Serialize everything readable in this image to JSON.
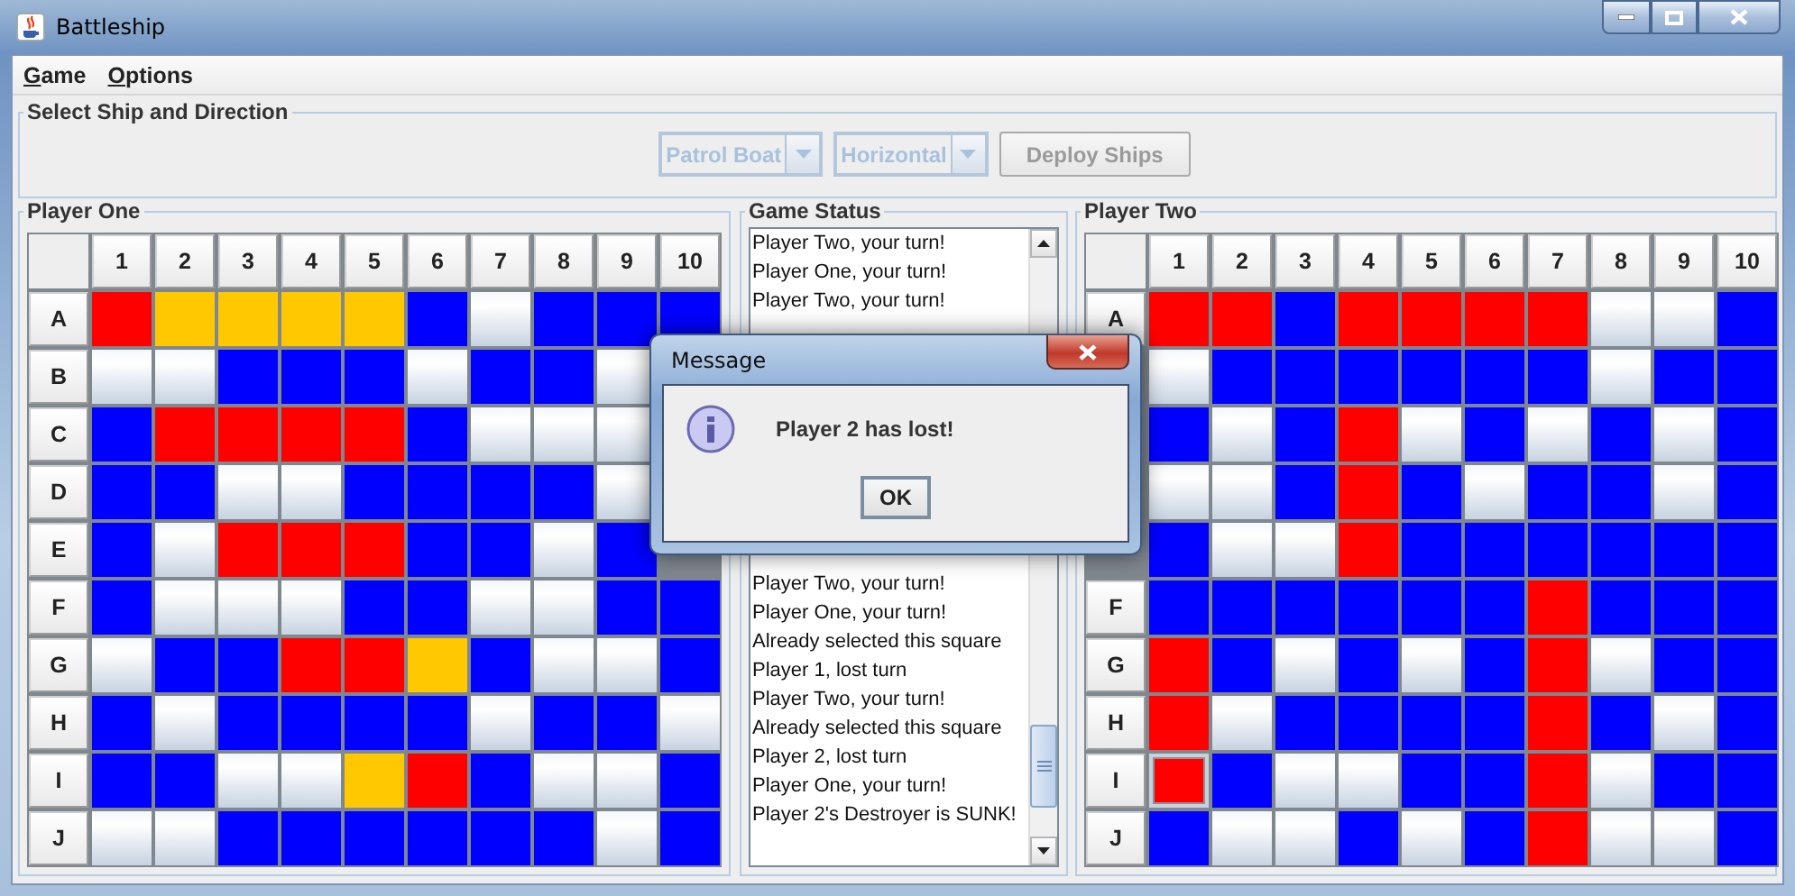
{
  "window": {
    "title": "Battleship"
  },
  "menu": [
    "Game",
    "Options"
  ],
  "setup": {
    "title": "Select Ship and Direction",
    "ship": {
      "value": "Patrol Boat",
      "disabled": true
    },
    "direction": {
      "value": "Horizontal",
      "disabled": true
    },
    "deploy": {
      "label": "Deploy Ships",
      "disabled": true
    }
  },
  "boards": [
    {
      "title": "Player One",
      "columns": [
        "1",
        "2",
        "3",
        "4",
        "5",
        "6",
        "7",
        "8",
        "9",
        "10"
      ],
      "rows": [
        {
          "label": "A",
          "cells": [
            {
              "kind": "hit"
            },
            {
              "kind": "ship"
            },
            {
              "kind": "ship"
            },
            {
              "kind": "ship"
            },
            {
              "kind": "ship"
            },
            {
              "kind": "water"
            },
            {
              "kind": "miss"
            },
            {
              "kind": "water"
            },
            {
              "kind": "water"
            },
            {
              "kind": "water"
            }
          ]
        },
        {
          "label": "B",
          "cells": [
            {
              "kind": "miss"
            },
            {
              "kind": "miss"
            },
            {
              "kind": "water"
            },
            {
              "kind": "water"
            },
            {
              "kind": "water"
            },
            {
              "kind": "miss"
            },
            {
              "kind": "water"
            },
            {
              "kind": "water"
            },
            {
              "kind": "miss"
            }
          ]
        },
        {
          "label": "C",
          "cells": [
            {
              "kind": "water"
            },
            {
              "kind": "hit"
            },
            {
              "kind": "hit"
            },
            {
              "kind": "hit"
            },
            {
              "kind": "hit"
            },
            {
              "kind": "water"
            },
            {
              "kind": "miss"
            },
            {
              "kind": "miss"
            },
            {
              "kind": "miss"
            }
          ]
        },
        {
          "label": "D",
          "cells": [
            {
              "kind": "water"
            },
            {
              "kind": "water"
            },
            {
              "kind": "miss"
            },
            {
              "kind": "miss"
            },
            {
              "kind": "water"
            },
            {
              "kind": "water"
            },
            {
              "kind": "water"
            },
            {
              "kind": "water"
            },
            {
              "kind": "miss"
            }
          ]
        },
        {
          "label": "E",
          "cells": [
            {
              "kind": "water"
            },
            {
              "kind": "miss"
            },
            {
              "kind": "hit"
            },
            {
              "kind": "hit"
            },
            {
              "kind": "hit"
            },
            {
              "kind": "water"
            },
            {
              "kind": "water"
            },
            {
              "kind": "miss"
            },
            {
              "kind": "water"
            }
          ]
        },
        {
          "label": "F",
          "cells": [
            {
              "kind": "water"
            },
            {
              "kind": "miss"
            },
            {
              "kind": "miss"
            },
            {
              "kind": "miss"
            },
            {
              "kind": "water"
            },
            {
              "kind": "water"
            },
            {
              "kind": "miss"
            },
            {
              "kind": "miss"
            },
            {
              "kind": "water"
            },
            {
              "kind": "water"
            }
          ]
        },
        {
          "label": "G",
          "cells": [
            {
              "kind": "miss"
            },
            {
              "kind": "water"
            },
            {
              "kind": "water"
            },
            {
              "kind": "hit"
            },
            {
              "kind": "hit"
            },
            {
              "kind": "ship"
            },
            {
              "kind": "water"
            },
            {
              "kind": "miss"
            },
            {
              "kind": "miss"
            },
            {
              "kind": "water"
            }
          ]
        },
        {
          "label": "H",
          "cells": [
            {
              "kind": "water"
            },
            {
              "kind": "miss"
            },
            {
              "kind": "water"
            },
            {
              "kind": "water"
            },
            {
              "kind": "water"
            },
            {
              "kind": "water"
            },
            {
              "kind": "miss"
            },
            {
              "kind": "water"
            },
            {
              "kind": "water"
            },
            {
              "kind": "miss"
            }
          ]
        },
        {
          "label": "I",
          "cells": [
            {
              "kind": "water"
            },
            {
              "kind": "water"
            },
            {
              "kind": "miss"
            },
            {
              "kind": "miss"
            },
            {
              "kind": "ship"
            },
            {
              "kind": "hit"
            },
            {
              "kind": "water"
            },
            {
              "kind": "miss"
            },
            {
              "kind": "miss"
            },
            {
              "kind": "water"
            }
          ]
        },
        {
          "label": "J",
          "cells": [
            {
              "kind": "miss"
            },
            {
              "kind": "miss"
            },
            {
              "kind": "water"
            },
            {
              "kind": "water"
            },
            {
              "kind": "water"
            },
            {
              "kind": "water"
            },
            {
              "kind": "water"
            },
            {
              "kind": "water"
            },
            {
              "kind": "miss"
            },
            {
              "kind": "water"
            }
          ]
        }
      ]
    },
    {
      "title": "Player Two",
      "columns": [
        "1",
        "2",
        "3",
        "4",
        "5",
        "6",
        "7",
        "8",
        "9",
        "10"
      ],
      "rows": [
        {
          "label": "A",
          "cells": [
            {
              "kind": "hit"
            },
            {
              "kind": "hit"
            },
            {
              "kind": "water"
            },
            {
              "kind": "hit"
            },
            {
              "kind": "hit"
            },
            {
              "kind": "hit"
            },
            {
              "kind": "hit"
            },
            {
              "kind": "miss"
            },
            {
              "kind": "miss"
            },
            {
              "kind": "water"
            }
          ]
        },
        {
          "cells": [
            {
              "kind": "miss"
            },
            {
              "kind": "water"
            },
            {
              "kind": "water"
            },
            {
              "kind": "water"
            },
            {
              "kind": "water"
            },
            {
              "kind": "water"
            },
            {
              "kind": "water"
            },
            {
              "kind": "miss"
            },
            {
              "kind": "water"
            },
            {
              "kind": "water"
            }
          ]
        },
        {
          "cells": [
            {
              "kind": "water"
            },
            {
              "kind": "miss"
            },
            {
              "kind": "water"
            },
            {
              "kind": "hit"
            },
            {
              "kind": "miss"
            },
            {
              "kind": "water"
            },
            {
              "kind": "miss"
            },
            {
              "kind": "water"
            },
            {
              "kind": "miss"
            },
            {
              "kind": "water"
            }
          ]
        },
        {
          "cells": [
            {
              "kind": "miss"
            },
            {
              "kind": "miss"
            },
            {
              "kind": "water"
            },
            {
              "kind": "hit"
            },
            {
              "kind": "water"
            },
            {
              "kind": "miss"
            },
            {
              "kind": "water"
            },
            {
              "kind": "water"
            },
            {
              "kind": "miss"
            },
            {
              "kind": "water"
            }
          ]
        },
        {
          "cells": [
            {
              "kind": "water"
            },
            {
              "kind": "miss"
            },
            {
              "kind": "miss"
            },
            {
              "kind": "hit"
            },
            {
              "kind": "water"
            },
            {
              "kind": "water"
            },
            {
              "kind": "water"
            },
            {
              "kind": "water"
            },
            {
              "kind": "water"
            },
            {
              "kind": "water"
            }
          ]
        },
        {
          "label": "F",
          "cells": [
            {
              "kind": "water"
            },
            {
              "kind": "water"
            },
            {
              "kind": "water"
            },
            {
              "kind": "water"
            },
            {
              "kind": "water"
            },
            {
              "kind": "water"
            },
            {
              "kind": "hit"
            },
            {
              "kind": "water"
            },
            {
              "kind": "water"
            },
            {
              "kind": "water"
            }
          ]
        },
        {
          "label": "G",
          "cells": [
            {
              "kind": "hit"
            },
            {
              "kind": "water"
            },
            {
              "kind": "miss"
            },
            {
              "kind": "water"
            },
            {
              "kind": "miss"
            },
            {
              "kind": "water"
            },
            {
              "kind": "hit"
            },
            {
              "kind": "miss"
            },
            {
              "kind": "water"
            },
            {
              "kind": "water"
            }
          ]
        },
        {
          "label": "H",
          "cells": [
            {
              "kind": "hit"
            },
            {
              "kind": "miss"
            },
            {
              "kind": "water"
            },
            {
              "kind": "water"
            },
            {
              "kind": "water"
            },
            {
              "kind": "water"
            },
            {
              "kind": "hit"
            },
            {
              "kind": "water"
            },
            {
              "kind": "miss"
            },
            {
              "kind": "water"
            }
          ]
        },
        {
          "label": "I",
          "cells": [
            {
              "kind": "focused"
            },
            {
              "kind": "water"
            },
            {
              "kind": "miss"
            },
            {
              "kind": "miss"
            },
            {
              "kind": "water"
            },
            {
              "kind": "water"
            },
            {
              "kind": "hit"
            },
            {
              "kind": "miss"
            },
            {
              "kind": "water"
            },
            {
              "kind": "water"
            }
          ]
        },
        {
          "label": "J",
          "cells": [
            {
              "kind": "water"
            },
            {
              "kind": "miss"
            },
            {
              "kind": "miss"
            },
            {
              "kind": "water"
            },
            {
              "kind": "miss"
            },
            {
              "kind": "water"
            },
            {
              "kind": "hit"
            },
            {
              "kind": "miss"
            },
            {
              "kind": "miss"
            },
            {
              "kind": "water"
            }
          ]
        }
      ]
    }
  ],
  "status": {
    "title": "Game Status",
    "log_top": [
      "Player Two, your turn!",
      "Player One, your turn!",
      "Player Two, your turn!"
    ],
    "log_bottom": [
      "Player Two, your turn!",
      "Player One, your turn!",
      "Already selected this square",
      "Player 1, lost turn",
      "Player Two, your turn!",
      "Already selected this square",
      "Player 2, lost turn",
      "Player One, your turn!",
      "Player 2's Destroyer is SUNK!"
    ]
  },
  "dialog": {
    "title": "Message",
    "message": "Player 2 has lost!",
    "button": "OK"
  }
}
